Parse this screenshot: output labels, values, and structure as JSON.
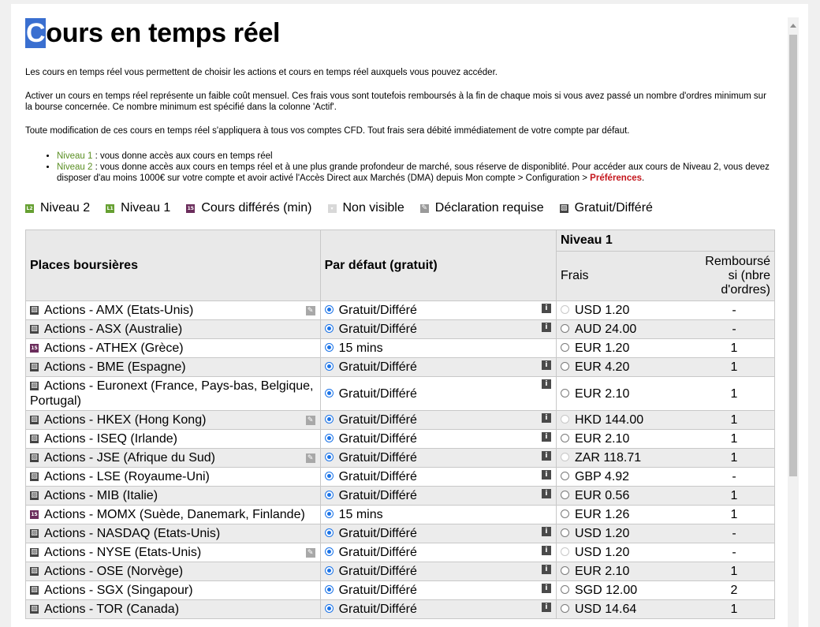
{
  "title": {
    "first_letter": "C",
    "rest": "ours en temps réel"
  },
  "intro": {
    "p1": "Les cours en temps réel vous permettent de choisir les actions et cours en temps réel auxquels vous pouvez accéder.",
    "p2": "Activer un cours en temps réel représente un faible coût mensuel. Ces frais vous sont toutefois remboursés à la fin de chaque mois si vous avez passé un nombre d'ordres minimum sur la bourse concernée. Ce nombre minimum est spécifié dans la colonne 'Actif'.",
    "p3": "Toute modification de ces cours en temps réel s'appliquera à tous vos comptes CFD. Tout frais sera débité immédiatement de votre compte par défaut."
  },
  "levels": {
    "n1_label": "Niveau 1",
    "n1_text": " : vous donne accès aux cours en temps réel",
    "n2_label": "Niveau 2",
    "n2_text": " : vous donne accès aux cours en temps réel et à une plus grande profondeur de marché, sous réserve de disponiblité. Pour accéder aux cours de Niveau 2, vous devez disposer d'au moins 1000€ sur votre compte et avoir activé l'Accès Direct aux Marchés (DMA) depuis Mon compte > Configuration > ",
    "pref_link": "Préférences",
    "end": "."
  },
  "legend": [
    {
      "icon": "level-2-icon",
      "badge": "L2",
      "cls": "l2",
      "label": "Niveau 2"
    },
    {
      "icon": "level-1-icon",
      "badge": "L1",
      "cls": "l1",
      "label": "Niveau 1"
    },
    {
      "icon": "delayed-15-icon",
      "badge": "15",
      "cls": "d15",
      "label": "Cours différés (min)"
    },
    {
      "icon": "not-visible-icon",
      "badge": "▾",
      "cls": "nv",
      "label": "Non visible"
    },
    {
      "icon": "declaration-required-icon",
      "badge": "✎",
      "cls": "decl",
      "label": "Déclaration requise"
    },
    {
      "icon": "free-delayed-icon",
      "badge": "▨",
      "cls": "grat",
      "label": "Gratuit/Différé"
    }
  ],
  "table": {
    "col_place": "Places boursières",
    "col_default": "Par défaut (gratuit)",
    "col_level1": "Niveau 1",
    "col_fees": "Frais",
    "col_reimbursed": "Remboursé si (nbre d'ordres)",
    "rows": [
      {
        "mark": "grat",
        "place": "Actions - AMX (Etats-Unis)",
        "decl": true,
        "default": "Gratuit/Différé",
        "info": true,
        "fee": "USD 1.20",
        "fee_disabled": true,
        "reimb": "-"
      },
      {
        "mark": "grat",
        "place": "Actions - ASX (Australie)",
        "decl": false,
        "default": "Gratuit/Différé",
        "info": true,
        "fee": "AUD 24.00",
        "fee_disabled": false,
        "reimb": "-"
      },
      {
        "mark": "d15",
        "place": "Actions - ATHEX (Grèce)",
        "decl": false,
        "default": "15 mins",
        "info": false,
        "fee": "EUR 1.20",
        "fee_disabled": false,
        "reimb": "1"
      },
      {
        "mark": "grat",
        "place": "Actions - BME (Espagne)",
        "decl": false,
        "default": "Gratuit/Différé",
        "info": true,
        "fee": "EUR 4.20",
        "fee_disabled": false,
        "reimb": "1"
      },
      {
        "mark": "grat",
        "place": "Actions - Euronext (France, Pays-bas, Belgique, Portugal)",
        "decl": false,
        "default": "Gratuit/Différé",
        "info": true,
        "fee": "EUR 2.10",
        "fee_disabled": false,
        "reimb": "1"
      },
      {
        "mark": "grat",
        "place": "Actions - HKEX (Hong Kong)",
        "decl": true,
        "default": "Gratuit/Différé",
        "info": true,
        "fee": "HKD 144.00",
        "fee_disabled": true,
        "reimb": "1"
      },
      {
        "mark": "grat",
        "place": "Actions - ISEQ (Irlande)",
        "decl": false,
        "default": "Gratuit/Différé",
        "info": true,
        "fee": "EUR 2.10",
        "fee_disabled": false,
        "reimb": "1"
      },
      {
        "mark": "grat",
        "place": "Actions - JSE (Afrique du Sud)",
        "decl": true,
        "default": "Gratuit/Différé",
        "info": true,
        "fee": "ZAR 118.71",
        "fee_disabled": true,
        "reimb": "1"
      },
      {
        "mark": "grat",
        "place": "Actions - LSE (Royaume-Uni)",
        "decl": false,
        "default": "Gratuit/Différé",
        "info": true,
        "fee": "GBP 4.92",
        "fee_disabled": false,
        "reimb": "-"
      },
      {
        "mark": "grat",
        "place": "Actions - MIB (Italie)",
        "decl": false,
        "default": "Gratuit/Différé",
        "info": true,
        "fee": "EUR 0.56",
        "fee_disabled": false,
        "reimb": "1"
      },
      {
        "mark": "d15",
        "place": "Actions - MOMX (Suède, Danemark, Finlande)",
        "decl": false,
        "default": "15 mins",
        "info": false,
        "fee": "EUR 1.26",
        "fee_disabled": false,
        "reimb": "1"
      },
      {
        "mark": "grat",
        "place": "Actions - NASDAQ (Etats-Unis)",
        "decl": false,
        "default": "Gratuit/Différé",
        "info": true,
        "fee": "USD 1.20",
        "fee_disabled": false,
        "reimb": "-"
      },
      {
        "mark": "grat",
        "place": "Actions - NYSE (Etats-Unis)",
        "decl": true,
        "default": "Gratuit/Différé",
        "info": true,
        "fee": "USD 1.20",
        "fee_disabled": true,
        "reimb": "-"
      },
      {
        "mark": "grat",
        "place": "Actions - OSE (Norvège)",
        "decl": false,
        "default": "Gratuit/Différé",
        "info": true,
        "fee": "EUR 2.10",
        "fee_disabled": false,
        "reimb": "1"
      },
      {
        "mark": "grat",
        "place": "Actions - SGX (Singapour)",
        "decl": false,
        "default": "Gratuit/Différé",
        "info": true,
        "fee": "SGD 12.00",
        "fee_disabled": false,
        "reimb": "2"
      },
      {
        "mark": "grat",
        "place": "Actions - TOR (Canada)",
        "decl": false,
        "default": "Gratuit/Différé",
        "info": true,
        "fee": "USD 14.64",
        "fee_disabled": false,
        "reimb": "1"
      }
    ]
  },
  "colors": {
    "accent": "#1a73e8",
    "level_green": "#66a032",
    "delayed_purple": "#6b2d5c",
    "link_red": "#c4161c"
  }
}
